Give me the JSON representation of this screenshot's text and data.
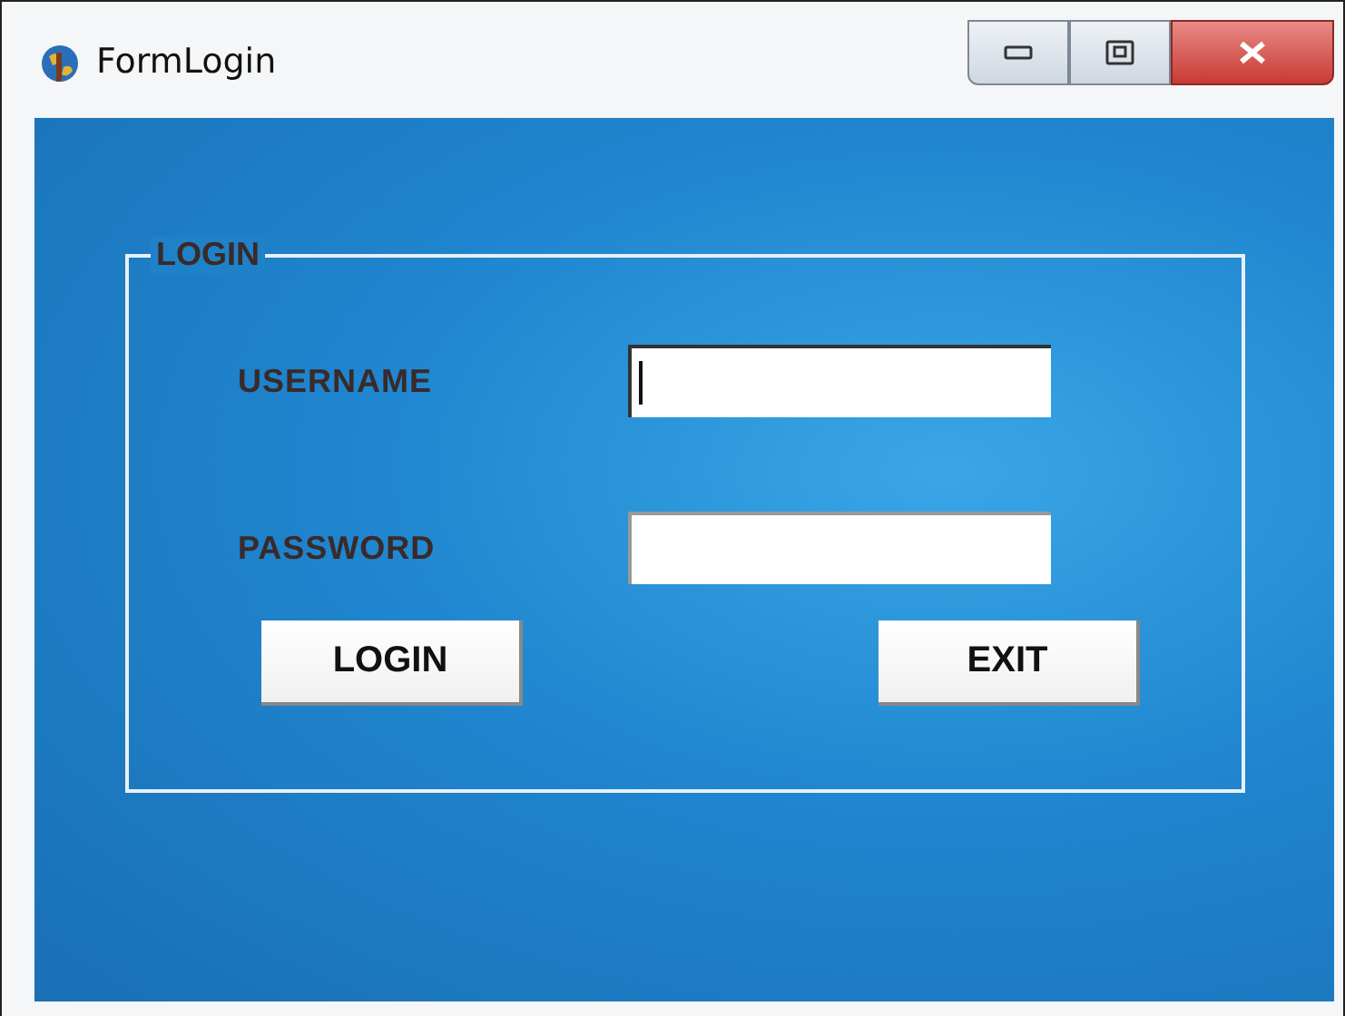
{
  "window": {
    "title": "FormLogin"
  },
  "group": {
    "title": "LOGIN"
  },
  "fields": [
    {
      "label": "USERNAME",
      "focused": true
    },
    {
      "label": "PASSWORD",
      "focused": false
    }
  ],
  "buttons": [
    "LOGIN",
    "EXIT"
  ]
}
